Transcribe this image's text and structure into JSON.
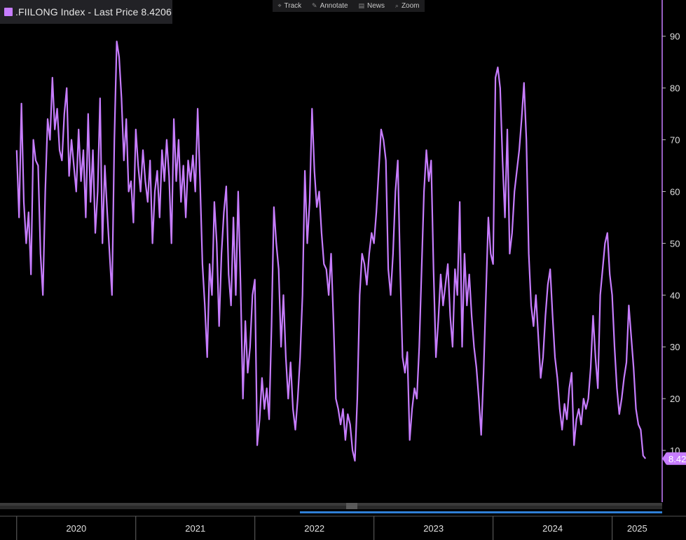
{
  "legend": {
    "text": ".FIILONG Index - Last Price 8.4206",
    "color": "#c77dff"
  },
  "toolbar": {
    "items": [
      {
        "label": "Track",
        "icon": "crosshair-icon",
        "glyph": "⌖"
      },
      {
        "label": "Annotate",
        "icon": "pencil-icon",
        "glyph": "✎"
      },
      {
        "label": "News",
        "icon": "news-icon",
        "glyph": "▤"
      },
      {
        "label": "Zoom",
        "icon": "magnifier-icon",
        "glyph": "⌕"
      }
    ]
  },
  "last_value_badge": "8.42",
  "chart_data": {
    "type": "line",
    "title": ".FIILONG Index",
    "series": [
      {
        "name": "Last Price",
        "color": "#c77dff",
        "points": [
          [
            2020.0,
            68
          ],
          [
            2020.02,
            55
          ],
          [
            2020.04,
            77
          ],
          [
            2020.06,
            58
          ],
          [
            2020.08,
            50
          ],
          [
            2020.1,
            56
          ],
          [
            2020.12,
            44
          ],
          [
            2020.14,
            70
          ],
          [
            2020.16,
            66
          ],
          [
            2020.18,
            65
          ],
          [
            2020.2,
            48
          ],
          [
            2020.22,
            40
          ],
          [
            2020.24,
            60
          ],
          [
            2020.26,
            74
          ],
          [
            2020.28,
            70
          ],
          [
            2020.3,
            82
          ],
          [
            2020.32,
            72
          ],
          [
            2020.34,
            76
          ],
          [
            2020.36,
            68
          ],
          [
            2020.38,
            66
          ],
          [
            2020.4,
            75
          ],
          [
            2020.42,
            80
          ],
          [
            2020.44,
            63
          ],
          [
            2020.46,
            70
          ],
          [
            2020.48,
            65
          ],
          [
            2020.5,
            60
          ],
          [
            2020.52,
            72
          ],
          [
            2020.54,
            62
          ],
          [
            2020.56,
            68
          ],
          [
            2020.58,
            55
          ],
          [
            2020.6,
            75
          ],
          [
            2020.62,
            58
          ],
          [
            2020.64,
            68
          ],
          [
            2020.66,
            52
          ],
          [
            2020.68,
            60
          ],
          [
            2020.7,
            78
          ],
          [
            2020.72,
            50
          ],
          [
            2020.74,
            65
          ],
          [
            2020.76,
            56
          ],
          [
            2020.78,
            48
          ],
          [
            2020.8,
            40
          ],
          [
            2020.82,
            70
          ],
          [
            2020.84,
            89
          ],
          [
            2020.86,
            86
          ],
          [
            2020.88,
            78
          ],
          [
            2020.9,
            66
          ],
          [
            2020.92,
            74
          ],
          [
            2020.94,
            60
          ],
          [
            2020.96,
            62
          ],
          [
            2020.98,
            54
          ],
          [
            2021.0,
            72
          ],
          [
            2021.02,
            65
          ],
          [
            2021.04,
            60
          ],
          [
            2021.06,
            68
          ],
          [
            2021.08,
            62
          ],
          [
            2021.1,
            58
          ],
          [
            2021.12,
            66
          ],
          [
            2021.14,
            50
          ],
          [
            2021.16,
            60
          ],
          [
            2021.18,
            64
          ],
          [
            2021.2,
            55
          ],
          [
            2021.22,
            68
          ],
          [
            2021.24,
            62
          ],
          [
            2021.26,
            70
          ],
          [
            2021.28,
            63
          ],
          [
            2021.3,
            50
          ],
          [
            2021.32,
            74
          ],
          [
            2021.34,
            62
          ],
          [
            2021.36,
            70
          ],
          [
            2021.38,
            58
          ],
          [
            2021.4,
            65
          ],
          [
            2021.42,
            55
          ],
          [
            2021.44,
            66
          ],
          [
            2021.46,
            62
          ],
          [
            2021.48,
            67
          ],
          [
            2021.5,
            60
          ],
          [
            2021.52,
            76
          ],
          [
            2021.54,
            62
          ],
          [
            2021.56,
            46
          ],
          [
            2021.58,
            38
          ],
          [
            2021.6,
            28
          ],
          [
            2021.62,
            46
          ],
          [
            2021.64,
            40
          ],
          [
            2021.66,
            58
          ],
          [
            2021.68,
            50
          ],
          [
            2021.7,
            34
          ],
          [
            2021.72,
            48
          ],
          [
            2021.74,
            56
          ],
          [
            2021.76,
            61
          ],
          [
            2021.78,
            44
          ],
          [
            2021.8,
            38
          ],
          [
            2021.82,
            55
          ],
          [
            2021.84,
            40
          ],
          [
            2021.86,
            60
          ],
          [
            2021.88,
            42
          ],
          [
            2021.9,
            20
          ],
          [
            2021.92,
            35
          ],
          [
            2021.94,
            25
          ],
          [
            2021.96,
            30
          ],
          [
            2021.98,
            40
          ],
          [
            2022.0,
            43
          ],
          [
            2022.02,
            11
          ],
          [
            2022.04,
            16
          ],
          [
            2022.06,
            24
          ],
          [
            2022.08,
            18
          ],
          [
            2022.1,
            22
          ],
          [
            2022.12,
            16
          ],
          [
            2022.14,
            34
          ],
          [
            2022.16,
            57
          ],
          [
            2022.18,
            50
          ],
          [
            2022.2,
            45
          ],
          [
            2022.22,
            30
          ],
          [
            2022.24,
            40
          ],
          [
            2022.26,
            28
          ],
          [
            2022.28,
            20
          ],
          [
            2022.3,
            27
          ],
          [
            2022.32,
            18
          ],
          [
            2022.34,
            14
          ],
          [
            2022.36,
            20
          ],
          [
            2022.38,
            28
          ],
          [
            2022.4,
            40
          ],
          [
            2022.42,
            64
          ],
          [
            2022.44,
            50
          ],
          [
            2022.46,
            58
          ],
          [
            2022.48,
            76
          ],
          [
            2022.5,
            64
          ],
          [
            2022.52,
            57
          ],
          [
            2022.54,
            60
          ],
          [
            2022.56,
            52
          ],
          [
            2022.58,
            46
          ],
          [
            2022.6,
            45
          ],
          [
            2022.62,
            40
          ],
          [
            2022.64,
            48
          ],
          [
            2022.66,
            35
          ],
          [
            2022.68,
            20
          ],
          [
            2022.7,
            18
          ],
          [
            2022.72,
            15
          ],
          [
            2022.74,
            18
          ],
          [
            2022.76,
            12
          ],
          [
            2022.78,
            17
          ],
          [
            2022.8,
            15
          ],
          [
            2022.82,
            10
          ],
          [
            2022.84,
            8
          ],
          [
            2022.86,
            20
          ],
          [
            2022.88,
            40
          ],
          [
            2022.9,
            48
          ],
          [
            2022.92,
            46
          ],
          [
            2022.94,
            42
          ],
          [
            2022.96,
            48
          ],
          [
            2022.98,
            52
          ],
          [
            2023.0,
            50
          ],
          [
            2023.02,
            56
          ],
          [
            2023.04,
            64
          ],
          [
            2023.06,
            72
          ],
          [
            2023.08,
            70
          ],
          [
            2023.1,
            66
          ],
          [
            2023.12,
            45
          ],
          [
            2023.14,
            40
          ],
          [
            2023.16,
            48
          ],
          [
            2023.18,
            60
          ],
          [
            2023.2,
            66
          ],
          [
            2023.22,
            45
          ],
          [
            2023.24,
            28
          ],
          [
            2023.26,
            25
          ],
          [
            2023.28,
            29
          ],
          [
            2023.3,
            12
          ],
          [
            2023.32,
            18
          ],
          [
            2023.34,
            22
          ],
          [
            2023.36,
            20
          ],
          [
            2023.38,
            30
          ],
          [
            2023.4,
            45
          ],
          [
            2023.42,
            60
          ],
          [
            2023.44,
            68
          ],
          [
            2023.46,
            62
          ],
          [
            2023.48,
            66
          ],
          [
            2023.5,
            45
          ],
          [
            2023.52,
            28
          ],
          [
            2023.54,
            35
          ],
          [
            2023.56,
            44
          ],
          [
            2023.58,
            38
          ],
          [
            2023.6,
            42
          ],
          [
            2023.62,
            46
          ],
          [
            2023.64,
            36
          ],
          [
            2023.66,
            30
          ],
          [
            2023.68,
            45
          ],
          [
            2023.7,
            40
          ],
          [
            2023.72,
            58
          ],
          [
            2023.74,
            30
          ],
          [
            2023.76,
            48
          ],
          [
            2023.78,
            38
          ],
          [
            2023.8,
            44
          ],
          [
            2023.82,
            36
          ],
          [
            2023.84,
            30
          ],
          [
            2023.86,
            26
          ],
          [
            2023.88,
            20
          ],
          [
            2023.9,
            13
          ],
          [
            2023.92,
            25
          ],
          [
            2023.94,
            40
          ],
          [
            2023.96,
            55
          ],
          [
            2023.98,
            48
          ],
          [
            2024.0,
            46
          ],
          [
            2024.02,
            82
          ],
          [
            2024.04,
            84
          ],
          [
            2024.06,
            80
          ],
          [
            2024.08,
            66
          ],
          [
            2024.1,
            55
          ],
          [
            2024.12,
            72
          ],
          [
            2024.14,
            48
          ],
          [
            2024.16,
            52
          ],
          [
            2024.18,
            60
          ],
          [
            2024.2,
            64
          ],
          [
            2024.22,
            68
          ],
          [
            2024.24,
            74
          ],
          [
            2024.26,
            81
          ],
          [
            2024.28,
            70
          ],
          [
            2024.3,
            48
          ],
          [
            2024.32,
            38
          ],
          [
            2024.34,
            34
          ],
          [
            2024.36,
            40
          ],
          [
            2024.38,
            32
          ],
          [
            2024.4,
            24
          ],
          [
            2024.42,
            28
          ],
          [
            2024.44,
            36
          ],
          [
            2024.46,
            42
          ],
          [
            2024.48,
            45
          ],
          [
            2024.5,
            36
          ],
          [
            2024.52,
            28
          ],
          [
            2024.54,
            24
          ],
          [
            2024.56,
            18
          ],
          [
            2024.58,
            14
          ],
          [
            2024.6,
            19
          ],
          [
            2024.62,
            16
          ],
          [
            2024.64,
            22
          ],
          [
            2024.66,
            25
          ],
          [
            2024.68,
            11
          ],
          [
            2024.7,
            16
          ],
          [
            2024.72,
            18
          ],
          [
            2024.74,
            15
          ],
          [
            2024.76,
            20
          ],
          [
            2024.78,
            18
          ],
          [
            2024.8,
            20
          ],
          [
            2024.82,
            26
          ],
          [
            2024.84,
            36
          ],
          [
            2024.86,
            28
          ],
          [
            2024.88,
            22
          ],
          [
            2024.9,
            40
          ],
          [
            2024.92,
            45
          ],
          [
            2024.94,
            50
          ],
          [
            2024.96,
            52
          ],
          [
            2024.98,
            44
          ],
          [
            2025.0,
            40
          ],
          [
            2025.02,
            30
          ],
          [
            2025.04,
            22
          ],
          [
            2025.06,
            17
          ],
          [
            2025.08,
            20
          ],
          [
            2025.1,
            24
          ],
          [
            2025.12,
            27
          ],
          [
            2025.14,
            38
          ],
          [
            2025.16,
            32
          ],
          [
            2025.18,
            26
          ],
          [
            2025.2,
            18
          ],
          [
            2025.22,
            15
          ],
          [
            2025.24,
            14
          ],
          [
            2025.26,
            9
          ],
          [
            2025.28,
            8.42
          ]
        ]
      }
    ],
    "x_ticks": [
      "2020",
      "2021",
      "2022",
      "2023",
      "2024",
      "2025"
    ],
    "x_tick_values": [
      2020,
      2021,
      2022,
      2023,
      2024,
      2025
    ],
    "y_ticks": [
      10,
      20,
      30,
      40,
      50,
      60,
      70,
      80,
      90
    ],
    "ylim": [
      0,
      97
    ],
    "xlim": [
      2019.86,
      2025.42
    ],
    "last_value": 8.42,
    "grid": false,
    "y_axis_side": "right"
  }
}
